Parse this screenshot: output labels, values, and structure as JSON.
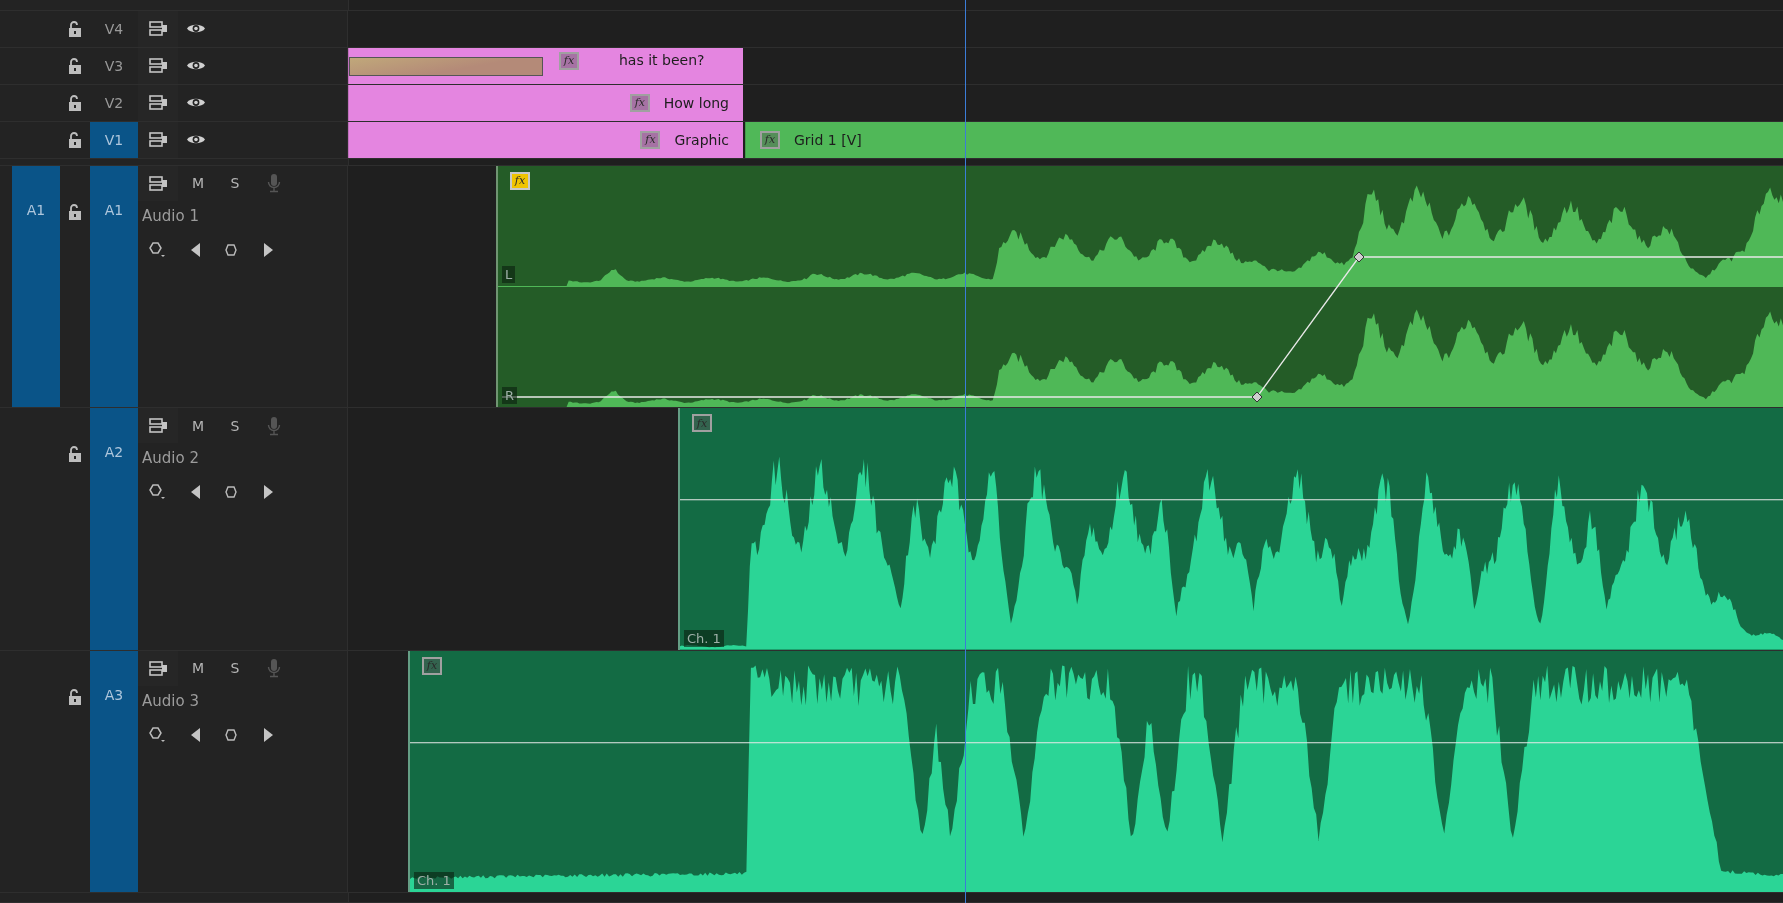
{
  "video_tracks": [
    {
      "target": "V4",
      "targeted": false
    },
    {
      "target": "V3",
      "targeted": false,
      "clips": [
        {
          "label": "has it been?",
          "fx": "fx",
          "fx_applied": false,
          "color": "#e485e0"
        }
      ]
    },
    {
      "target": "V2",
      "targeted": false,
      "clips": [
        {
          "label": "How long",
          "fx": "fx",
          "fx_applied": false,
          "color": "#e485e0"
        }
      ]
    },
    {
      "target": "V1",
      "targeted": true,
      "clips": [
        {
          "label": "Graphic",
          "fx": "fx",
          "fx_applied": false,
          "color": "#e485e0"
        },
        {
          "label": "Grid 1 [V]",
          "fx": "fx",
          "fx_applied": false,
          "color": "#50b858"
        }
      ]
    }
  ],
  "audio_tracks": [
    {
      "source": "A1",
      "target": "A1",
      "targeted": true,
      "name": "Audio 1",
      "mute": "M",
      "solo": "S",
      "clips": [
        {
          "fx": "fx",
          "fx_applied": true,
          "color": "#4fb857",
          "channels": [
            "L",
            "R"
          ]
        }
      ]
    },
    {
      "target": "A2",
      "targeted": true,
      "name": "Audio 2",
      "mute": "M",
      "solo": "S",
      "clips": [
        {
          "fx": "fx",
          "fx_applied": false,
          "color": "#2bd596",
          "channels": [
            "Ch. 1"
          ]
        }
      ]
    },
    {
      "target": "A3",
      "targeted": true,
      "name": "Audio 3",
      "mute": "M",
      "solo": "S",
      "clips": [
        {
          "fx": "fx",
          "fx_applied": false,
          "color": "#2bd596",
          "channels": [
            "Ch. 1"
          ]
        }
      ]
    }
  ]
}
